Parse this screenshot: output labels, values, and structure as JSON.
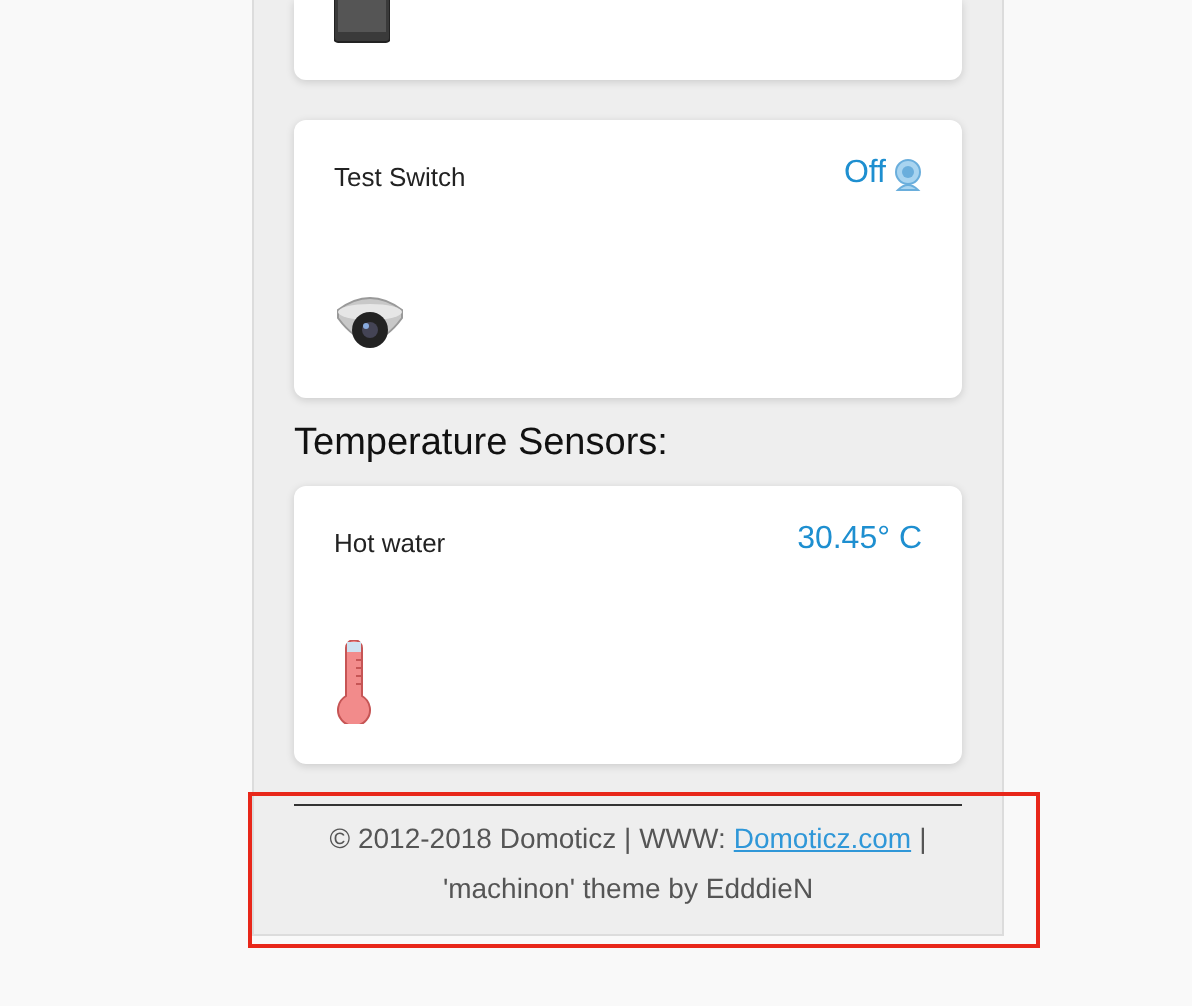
{
  "sections": [
    {
      "devices": [
        {
          "kind": "tablet",
          "clipped": true
        }
      ]
    },
    {
      "devices": [
        {
          "kind": "camera",
          "name": "Test Switch",
          "status": "Off",
          "clipped": false
        }
      ]
    },
    {
      "heading": "Temperature Sensors:",
      "devices": [
        {
          "kind": "thermometer",
          "name": "Hot water",
          "status": "30.45° C",
          "clipped": false
        }
      ]
    }
  ],
  "footer": {
    "copyright": "© 2012-2018 Domoticz | WWW:",
    "link": "Domoticz.com",
    "separator": "|",
    "theme": "'machinon' theme by EdddieN",
    "highlighted": true
  }
}
